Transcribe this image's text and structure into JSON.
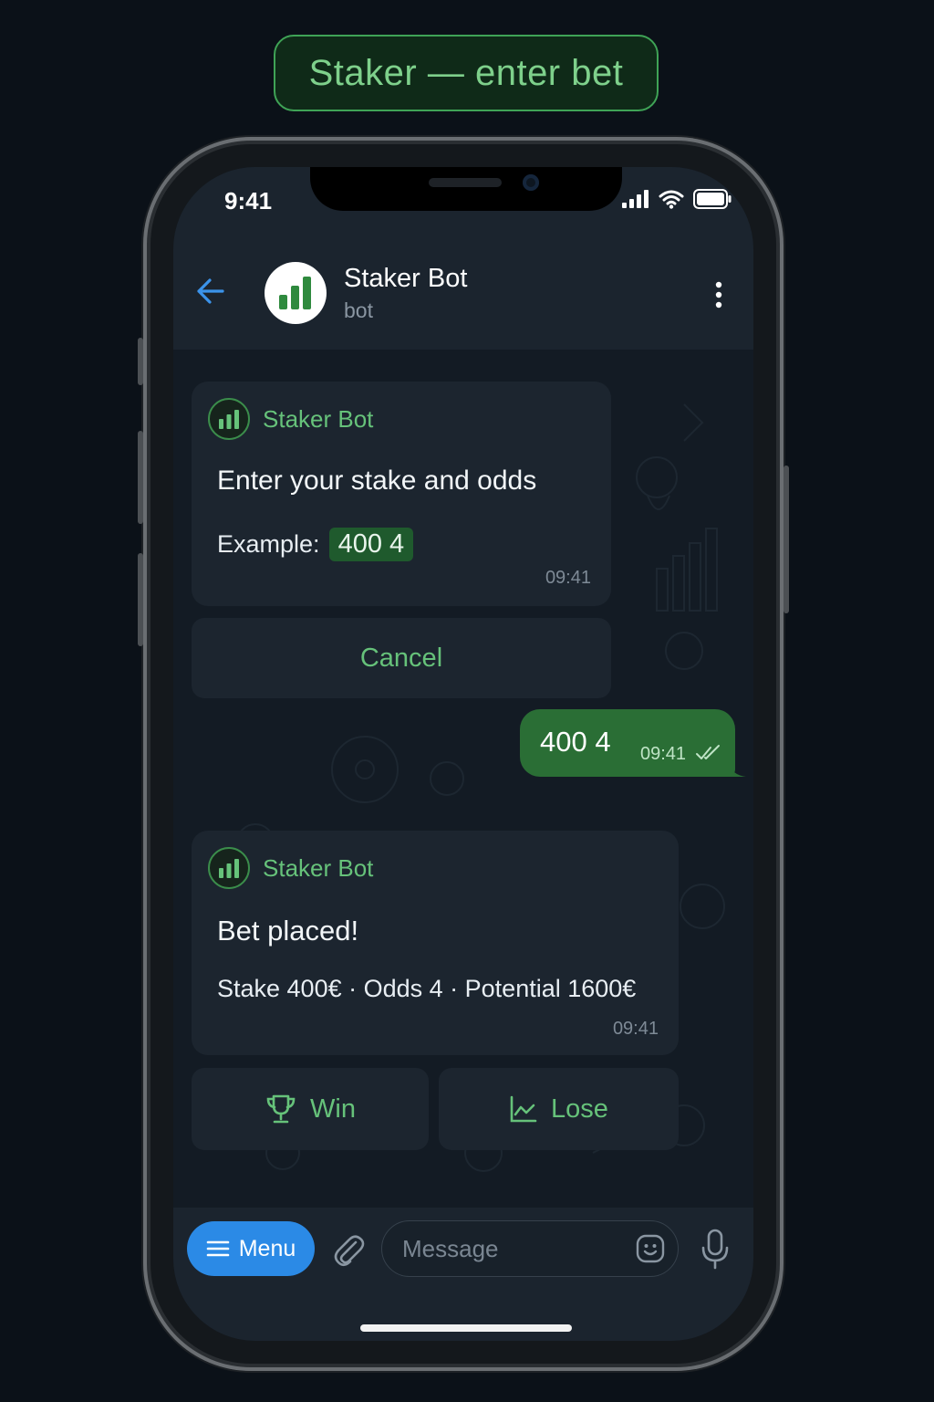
{
  "caption": "Staker — enter bet",
  "status_bar": {
    "time": "9:41"
  },
  "header": {
    "title": "Staker Bot",
    "subtitle": "bot"
  },
  "messages": {
    "first": {
      "sender": "Staker Bot",
      "text": "Enter your stake and odds",
      "example_label": "Example:",
      "example_value": "400 4",
      "time": "09:41"
    },
    "cancel_label": "Cancel",
    "user": {
      "text": "400 4",
      "time": "09:41"
    },
    "second": {
      "sender": "Staker Bot",
      "title": "Bet placed!",
      "details": "Stake 400€ · Odds 4 · Potential 1600€",
      "time": "09:41"
    },
    "win_label": "Win",
    "lose_label": "Lose"
  },
  "input_bar": {
    "menu_label": "Menu",
    "placeholder": "Message"
  },
  "colors": {
    "accent_green": "#66c27a",
    "menu_blue": "#2b8ae6",
    "user_bubble": "#2a6e35"
  }
}
